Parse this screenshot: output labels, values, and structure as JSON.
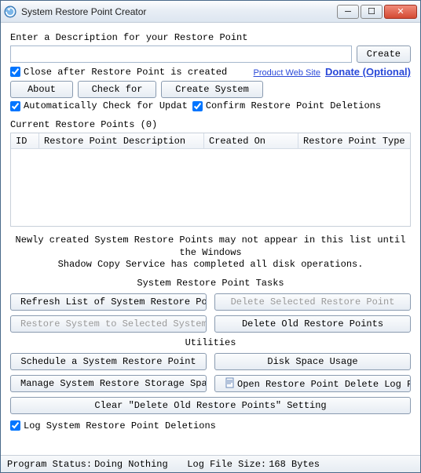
{
  "title": "System Restore Point Creator",
  "desc_label": "Enter a Description for your Restore Point",
  "desc_value": "",
  "create_btn": "Create",
  "close_after": "Close after Restore Point is created",
  "link_site": "Product Web Site",
  "link_donate": "Donate (Optional)",
  "btn_about": "About",
  "btn_check": "Check for",
  "btn_create_sys": "Create System",
  "auto_check": "Automatically Check for Updat",
  "confirm_del": "Confirm Restore Point Deletions",
  "current_points": "Current Restore Points (0)",
  "cols": {
    "id": "ID",
    "desc": "Restore Point Description",
    "created": "Created On",
    "type": "Restore Point Type"
  },
  "note": "Newly created System Restore Points may not appear in this list until the Windows\nShadow Copy Service has completed all disk operations.",
  "tasks_title": "System Restore Point Tasks",
  "btn_refresh": "Refresh List of System Restore Points",
  "btn_del_sel": "Delete Selected Restore Point",
  "btn_restore": "Restore System to Selected System",
  "btn_del_old": "Delete Old Restore Points",
  "util_title": "Utilities",
  "btn_schedule": "Schedule a System Restore Point",
  "btn_disk": "Disk Space Usage",
  "btn_manage": "Manage System Restore Storage Space",
  "btn_openlog": "Open Restore Point Delete Log File",
  "btn_clear": "Clear \"Delete Old Restore Points\" Setting",
  "log_del": "Log System Restore Point Deletions",
  "status_label": "Program Status:",
  "status_val": "Doing Nothing",
  "logsize_label": "Log File Size:",
  "logsize_val": "168 Bytes"
}
